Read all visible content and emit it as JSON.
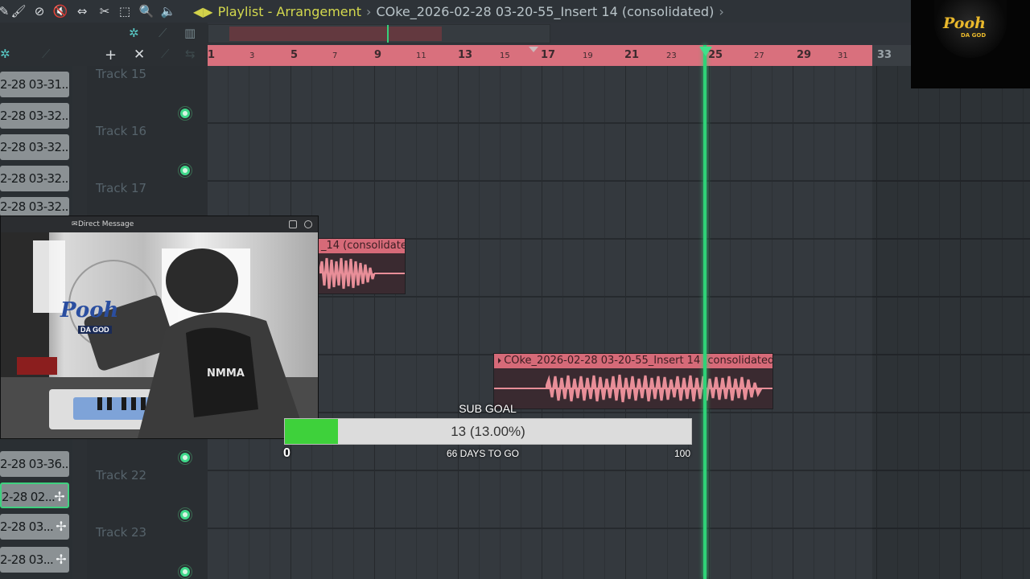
{
  "window": {
    "title_prefix": "Playlist - Arrangement",
    "separator": "›",
    "pattern_name": "COke_2026-02-28 03-20-55_Insert 14 (consolidated)",
    "end_separator": "›"
  },
  "toolbar_icons": [
    "pencil-icon",
    "paint-icon",
    "delete-icon",
    "mute-icon",
    "slip-icon",
    "slice-icon",
    "select-icon",
    "zoom-icon",
    "playback-icon"
  ],
  "ruler": {
    "bars": [
      "1",
      "3",
      "5",
      "7",
      "9",
      "11",
      "13",
      "15",
      "17",
      "19",
      "21",
      "23",
      "25",
      "27",
      "29",
      "31"
    ],
    "end_bar": "33"
  },
  "clip_list": [
    "2-28 03-31...",
    "2-28 03-32...",
    "2-28 03-32...",
    "2-28 03-32...",
    "2-28 03-32...",
    "2-28 03-36...",
    "2-28 02...",
    "2-28 03...",
    "2-28 03..."
  ],
  "tracks": [
    {
      "name": "Track 15"
    },
    {
      "name": "Track 16"
    },
    {
      "name": "Track 17"
    },
    {
      "name": "Track 22"
    },
    {
      "name": "Track 23"
    }
  ],
  "clips": [
    {
      "label": "_14 (consolidated)"
    },
    {
      "label": "COke_2026-02-28 03-20-55_Insert 14 (consolidated)"
    }
  ],
  "webcam": {
    "title": "Direct Message",
    "overlay_brand": "Pooh",
    "overlay_sub": "DA GOD",
    "shirt_text": "NMMA"
  },
  "sub_goal": {
    "title": "SUB GOAL",
    "current": 13,
    "target": 100,
    "progress_fraction": 0.13,
    "label": "13 (13.00%)",
    "min_label": "0",
    "max_label": "100",
    "days_label": "66 DAYS TO GO"
  },
  "logo": {
    "text": "Pooh",
    "sub": "DA GOD"
  },
  "colors": {
    "accent_green": "#2fd177",
    "clip_red": "#d66a78",
    "title_yellow": "#d4d94e",
    "progress_green": "#3ed13b"
  }
}
